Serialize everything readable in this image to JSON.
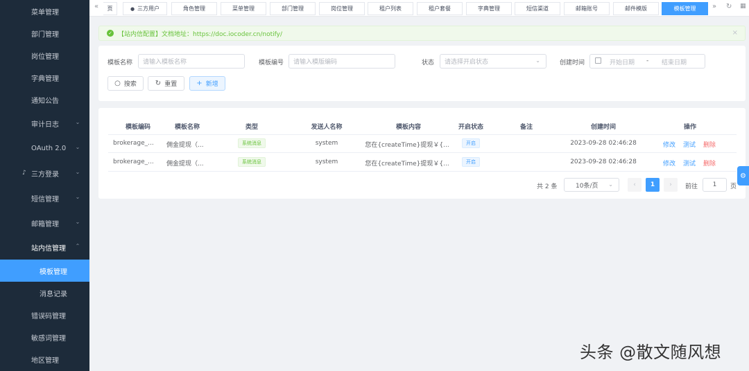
{
  "sidebar": {
    "items": [
      {
        "label": "菜单管理",
        "chevron": ""
      },
      {
        "label": "部门管理",
        "chevron": ""
      },
      {
        "label": "岗位管理",
        "chevron": ""
      },
      {
        "label": "字典管理",
        "chevron": ""
      },
      {
        "label": "通知公告",
        "chevron": ""
      },
      {
        "label": "审计日志",
        "chevron": "⌄"
      },
      {
        "label": "OAuth 2.0",
        "chevron": "⌄"
      },
      {
        "label": "三方登录",
        "chevron": "⌄"
      },
      {
        "label": "短信管理",
        "chevron": "⌄"
      },
      {
        "label": "邮箱管理",
        "chevron": "⌄"
      },
      {
        "label": "站内信管理",
        "chevron": "⌃"
      },
      {
        "label": "模板管理",
        "chevron": ""
      },
      {
        "label": "消息记录",
        "chevron": ""
      },
      {
        "label": "错误码管理",
        "chevron": ""
      },
      {
        "label": "敏感词管理",
        "chevron": ""
      },
      {
        "label": "地区管理",
        "chevron": ""
      }
    ]
  },
  "tabs": {
    "items": [
      "页",
      "三方用户",
      "角色管理",
      "菜单管理",
      "部门管理",
      "岗位管理",
      "租户列表",
      "租户套餐",
      "字典管理",
      "短信渠道",
      "邮箱账号",
      "邮件模版",
      "模板管理"
    ]
  },
  "alert": {
    "text": "【站内信配置】文档地址：https://doc.iocoder.cn/notify/"
  },
  "search": {
    "name_label": "模板名称",
    "name_placeholder": "请输入模板名称",
    "code_label": "模板编号",
    "code_placeholder": "请输入模版编码",
    "status_label": "状态",
    "status_placeholder": "请选择开启状态",
    "created_label": "创建时间",
    "start_placeholder": "开始日期",
    "date_sep": "-",
    "end_placeholder": "结束日期",
    "search_btn": "搜索",
    "reset_btn": "重置",
    "add_btn": "新增"
  },
  "table": {
    "headers": [
      "模板编码",
      "模板名称",
      "类型",
      "发送人名称",
      "模板内容",
      "开启状态",
      "备注",
      "创建时间",
      "操作"
    ],
    "rows": [
      {
        "code": "brokerage_...",
        "name": "佣金提现（...",
        "type": "系统消息",
        "sender": "system",
        "content": "您在{createTime}提现￥{...",
        "status": "开启",
        "remark": "",
        "created": "2023-09-28 02:46:28"
      },
      {
        "code": "brokerage_...",
        "name": "佣金提现（...",
        "type": "系统消息",
        "sender": "system",
        "content": "您在{createTime}提现￥{...",
        "status": "开启",
        "remark": "",
        "created": "2023-09-28 02:46:28"
      }
    ],
    "actions": {
      "edit": "修改",
      "test": "测试",
      "delete": "删除"
    }
  },
  "pagination": {
    "total": "共 2 条",
    "page_size": "10条/页",
    "current": "1",
    "goto_label": "前往",
    "goto_value": "1",
    "page_suffix": "页"
  },
  "watermark": "头条 @散文随风想",
  "colors": {
    "primary": "#409eff",
    "sidebar_bg": "#1d2b3a",
    "success": "#67c23a",
    "danger": "#f56c6c"
  }
}
